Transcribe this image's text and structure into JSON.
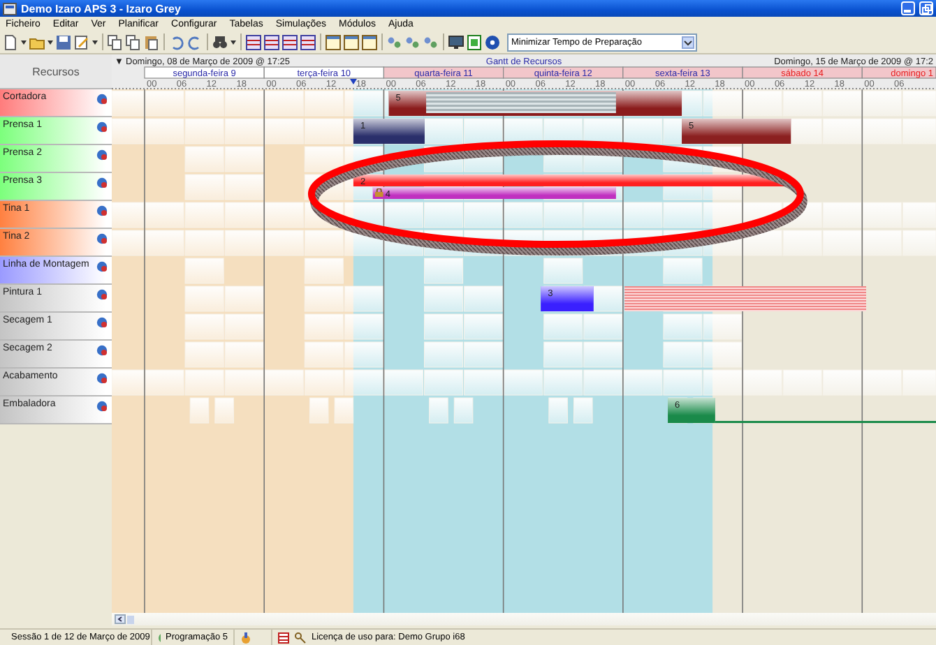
{
  "window": {
    "title": "Demo Izaro APS 3 - Izaro Grey"
  },
  "menu": [
    "Ficheiro",
    "Editar",
    "Ver",
    "Planificar",
    "Configurar",
    "Tabelas",
    "Simulações",
    "Módulos",
    "Ajuda"
  ],
  "toolbar": {
    "objective": {
      "value": "Minimizar Tempo de Preparação"
    }
  },
  "gantt": {
    "resources_heading": "Recursos",
    "collapse_glyph": "▼",
    "title": "Gantt de Recursos",
    "range_start_label": "Domingo, 08 de Março de 2009 @ 17:25",
    "range_end_label": "Domingo, 15 de Março de 2009 @ 17:2",
    "days": [
      {
        "label": "segunda-feira 9",
        "highlighted": false,
        "weekend": false,
        "hours": [
          "00",
          "06",
          "12",
          "18"
        ]
      },
      {
        "label": "terça-feira 10",
        "highlighted": false,
        "weekend": false,
        "hours": [
          "00",
          "06",
          "12",
          "18"
        ]
      },
      {
        "label": "quarta-feira 11",
        "highlighted": true,
        "weekend": false,
        "hours": [
          "00",
          "06",
          "12",
          "18"
        ]
      },
      {
        "label": "quinta-feira 12",
        "highlighted": true,
        "weekend": false,
        "hours": [
          "00",
          "06",
          "12",
          "18"
        ]
      },
      {
        "label": "sexta-feira 13",
        "highlighted": true,
        "weekend": false,
        "hours": [
          "00",
          "06",
          "12",
          "18"
        ]
      },
      {
        "label": "sábado 14",
        "highlighted": true,
        "weekend": true,
        "hours": [
          "00",
          "06",
          "12",
          "18"
        ]
      },
      {
        "label": "domingo 1",
        "highlighted": true,
        "weekend": true,
        "hours": [
          "00",
          "06"
        ]
      }
    ],
    "resources": [
      {
        "name": "Cortadora",
        "color": "#ff7c7c",
        "kind": "three_shifts",
        "tasks": [
          {
            "label": "5",
            "color": "#8b1c1c",
            "idle": true
          }
        ]
      },
      {
        "name": "Prensa 1",
        "color": "#7cff7c",
        "kind": "three_shifts",
        "tasks": [
          {
            "label": "1",
            "color": "#2a2f6b"
          },
          {
            "label": "5",
            "color": "#8b2020"
          }
        ]
      },
      {
        "name": "Prensa 2",
        "color": "#7cff7c",
        "kind": "two_shifts"
      },
      {
        "name": "Prensa 3",
        "color": "#7cff7c",
        "kind": "two_shifts",
        "highlighted": true,
        "tasks": [
          {
            "label": "2",
            "color": "#ff2020"
          },
          {
            "label": "4",
            "color": "#c030c0",
            "locked": true
          }
        ]
      },
      {
        "name": "Tina 1",
        "color": "#ff8040",
        "kind": "three_shifts"
      },
      {
        "name": "Tina 2",
        "color": "#ff8040",
        "kind": "three_shifts"
      },
      {
        "name": "Linha de Montagem",
        "color": "#9a9aff",
        "kind": "one_shift"
      },
      {
        "name": "Pintura 1",
        "color": "#c4c4c4",
        "kind": "two_shifts",
        "tasks": [
          {
            "label": "3",
            "color": "#3a20ff"
          }
        ],
        "blocked": true
      },
      {
        "name": "Secagem 1",
        "color": "#c4c4c4",
        "kind": "two_shifts"
      },
      {
        "name": "Secagem 2",
        "color": "#c4c4c4",
        "kind": "two_shifts"
      },
      {
        "name": "Acabamento",
        "color": "#c4c4c4",
        "kind": "three_shifts"
      },
      {
        "name": "Embaladora",
        "color": "#c4c4c4",
        "kind": "split_shift",
        "tasks": [
          {
            "label": "6",
            "color": "#1a8a4a",
            "continues": true
          }
        ]
      }
    ]
  },
  "status_bar": {
    "session": "Sessão 1 de 12 de Março de 2009",
    "schedule": "Programação 5",
    "license": "Licença de uso para: Demo Grupo i68"
  }
}
